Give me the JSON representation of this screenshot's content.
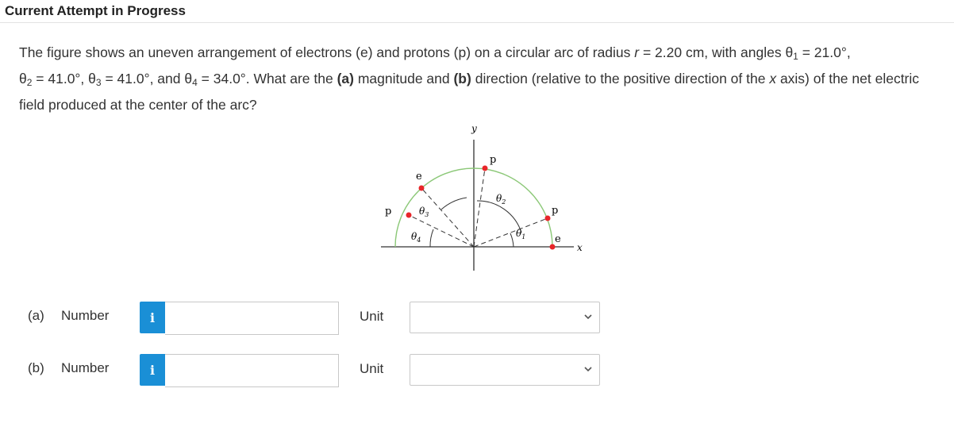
{
  "header": {
    "title": "Current Attempt in Progress"
  },
  "question": {
    "seg1": "The figure shows an uneven arrangement of electrons (e) and protons (p) on a circular arc of radius ",
    "r_var": "r",
    "seg2": " = 2.20 cm, with angles ",
    "theta": "θ",
    "sub1": "1",
    "seg3": " = 21.0°,",
    "sub2": "2",
    "seg4": " = 41.0°, ",
    "sub3": "3",
    "seg5": " = 41.0°, and ",
    "sub4": "4",
    "seg6": " = 34.0°. What are the ",
    "bold_a": "(a)",
    "seg7": " magnitude and ",
    "bold_b": "(b)",
    "seg8": " direction (relative to the positive direction of the ",
    "x_var": "x",
    "seg9": " axis) of the net electric field produced at the center of the arc?"
  },
  "figure": {
    "axis_y": "y",
    "axis_x": "x",
    "charges": [
      {
        "label": "p"
      },
      {
        "label": "p"
      },
      {
        "label": "e"
      },
      {
        "label": "e"
      },
      {
        "label": "p"
      }
    ],
    "angle_labels": [
      {
        "sym": "θ",
        "sub": "1"
      },
      {
        "sym": "θ",
        "sub": "2"
      },
      {
        "sym": "θ",
        "sub": "3"
      },
      {
        "sym": "θ",
        "sub": "4"
      }
    ],
    "colors": {
      "arc": "#8cc878",
      "charge": "#e8262a",
      "axis": "#333333"
    }
  },
  "answers": [
    {
      "part": "(a)",
      "label": "Number",
      "info_icon": "i",
      "value": "",
      "unit_label": "Unit",
      "unit_value": ""
    },
    {
      "part": "(b)",
      "label": "Number",
      "info_icon": "i",
      "value": "",
      "unit_label": "Unit",
      "unit_value": ""
    }
  ],
  "colors": {
    "info_button": "#1a8fd6",
    "header_border": "#e3e3e3"
  }
}
